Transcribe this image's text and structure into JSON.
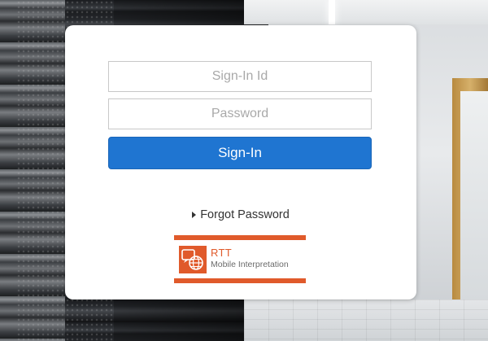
{
  "login": {
    "id_placeholder": "Sign-In Id",
    "password_placeholder": "Password",
    "signin_label": "Sign-In",
    "forgot_label": "Forgot Password"
  },
  "brand": {
    "name": "RTT",
    "tagline": "Mobile Interpretation",
    "color": "#e05a2b"
  },
  "colors": {
    "primary_button": "#1f75d1",
    "card_background": "#ffffff"
  }
}
